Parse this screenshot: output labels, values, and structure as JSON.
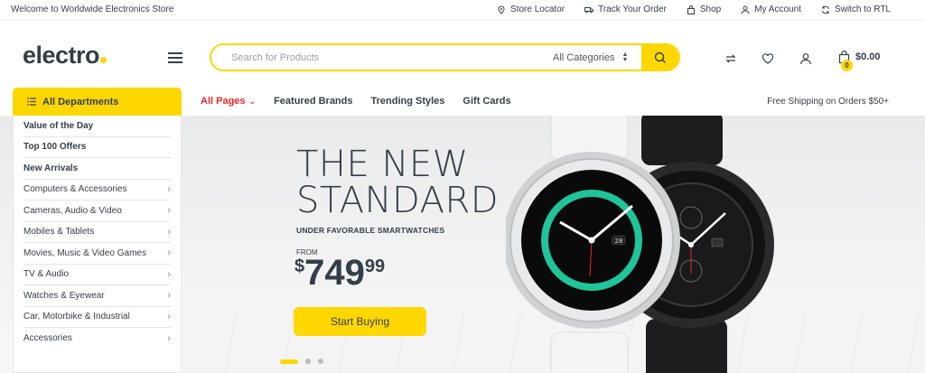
{
  "topbar": {
    "welcome": "Welcome to Worldwide Electronics Store",
    "links": [
      {
        "label": "Store Locator",
        "icon": "map-pin-icon"
      },
      {
        "label": "Track Your Order",
        "icon": "truck-icon"
      },
      {
        "label": "Shop",
        "icon": "bag-icon"
      },
      {
        "label": "My Account",
        "icon": "user-icon"
      },
      {
        "label": "Switch to RTL",
        "icon": "refresh-icon"
      }
    ]
  },
  "header": {
    "logo": "electro",
    "search_placeholder": "Search for Products",
    "category_selected": "All Categories",
    "cart_count": "0",
    "cart_total": "$0.00"
  },
  "nav": {
    "all_departments": "All Departments",
    "items": [
      "All Pages",
      "Featured Brands",
      "Trending Styles",
      "Gift Cards"
    ],
    "shipping": "Free Shipping on Orders $50+"
  },
  "sidebar": {
    "items": [
      {
        "label": "Value of the Day",
        "bold": true
      },
      {
        "label": "Top 100 Offers",
        "bold": true
      },
      {
        "label": "New Arrivals",
        "bold": true
      },
      {
        "label": "Computers & Accessories",
        "bold": false
      },
      {
        "label": "Cameras, Audio & Video",
        "bold": false
      },
      {
        "label": "Mobiles & Tablets",
        "bold": false
      },
      {
        "label": "Movies, Music & Video Games",
        "bold": false
      },
      {
        "label": "TV & Audio",
        "bold": false
      },
      {
        "label": "Watches & Eyewear",
        "bold": false
      },
      {
        "label": "Car, Motorbike & Industrial",
        "bold": false
      },
      {
        "label": "Accessories",
        "bold": false
      }
    ]
  },
  "hero": {
    "line1": "THE NEW",
    "line2": "STANDARD",
    "subtitle": "UNDER FAVORABLE SMARTWATCHES",
    "from": "FROM",
    "price_currency": "$",
    "price_whole": "749",
    "price_cents": "99",
    "cta": "Start Buying",
    "watch_date": "28"
  },
  "colors": {
    "accent": "#fed700",
    "text": "#333e48",
    "active": "#e52828"
  }
}
